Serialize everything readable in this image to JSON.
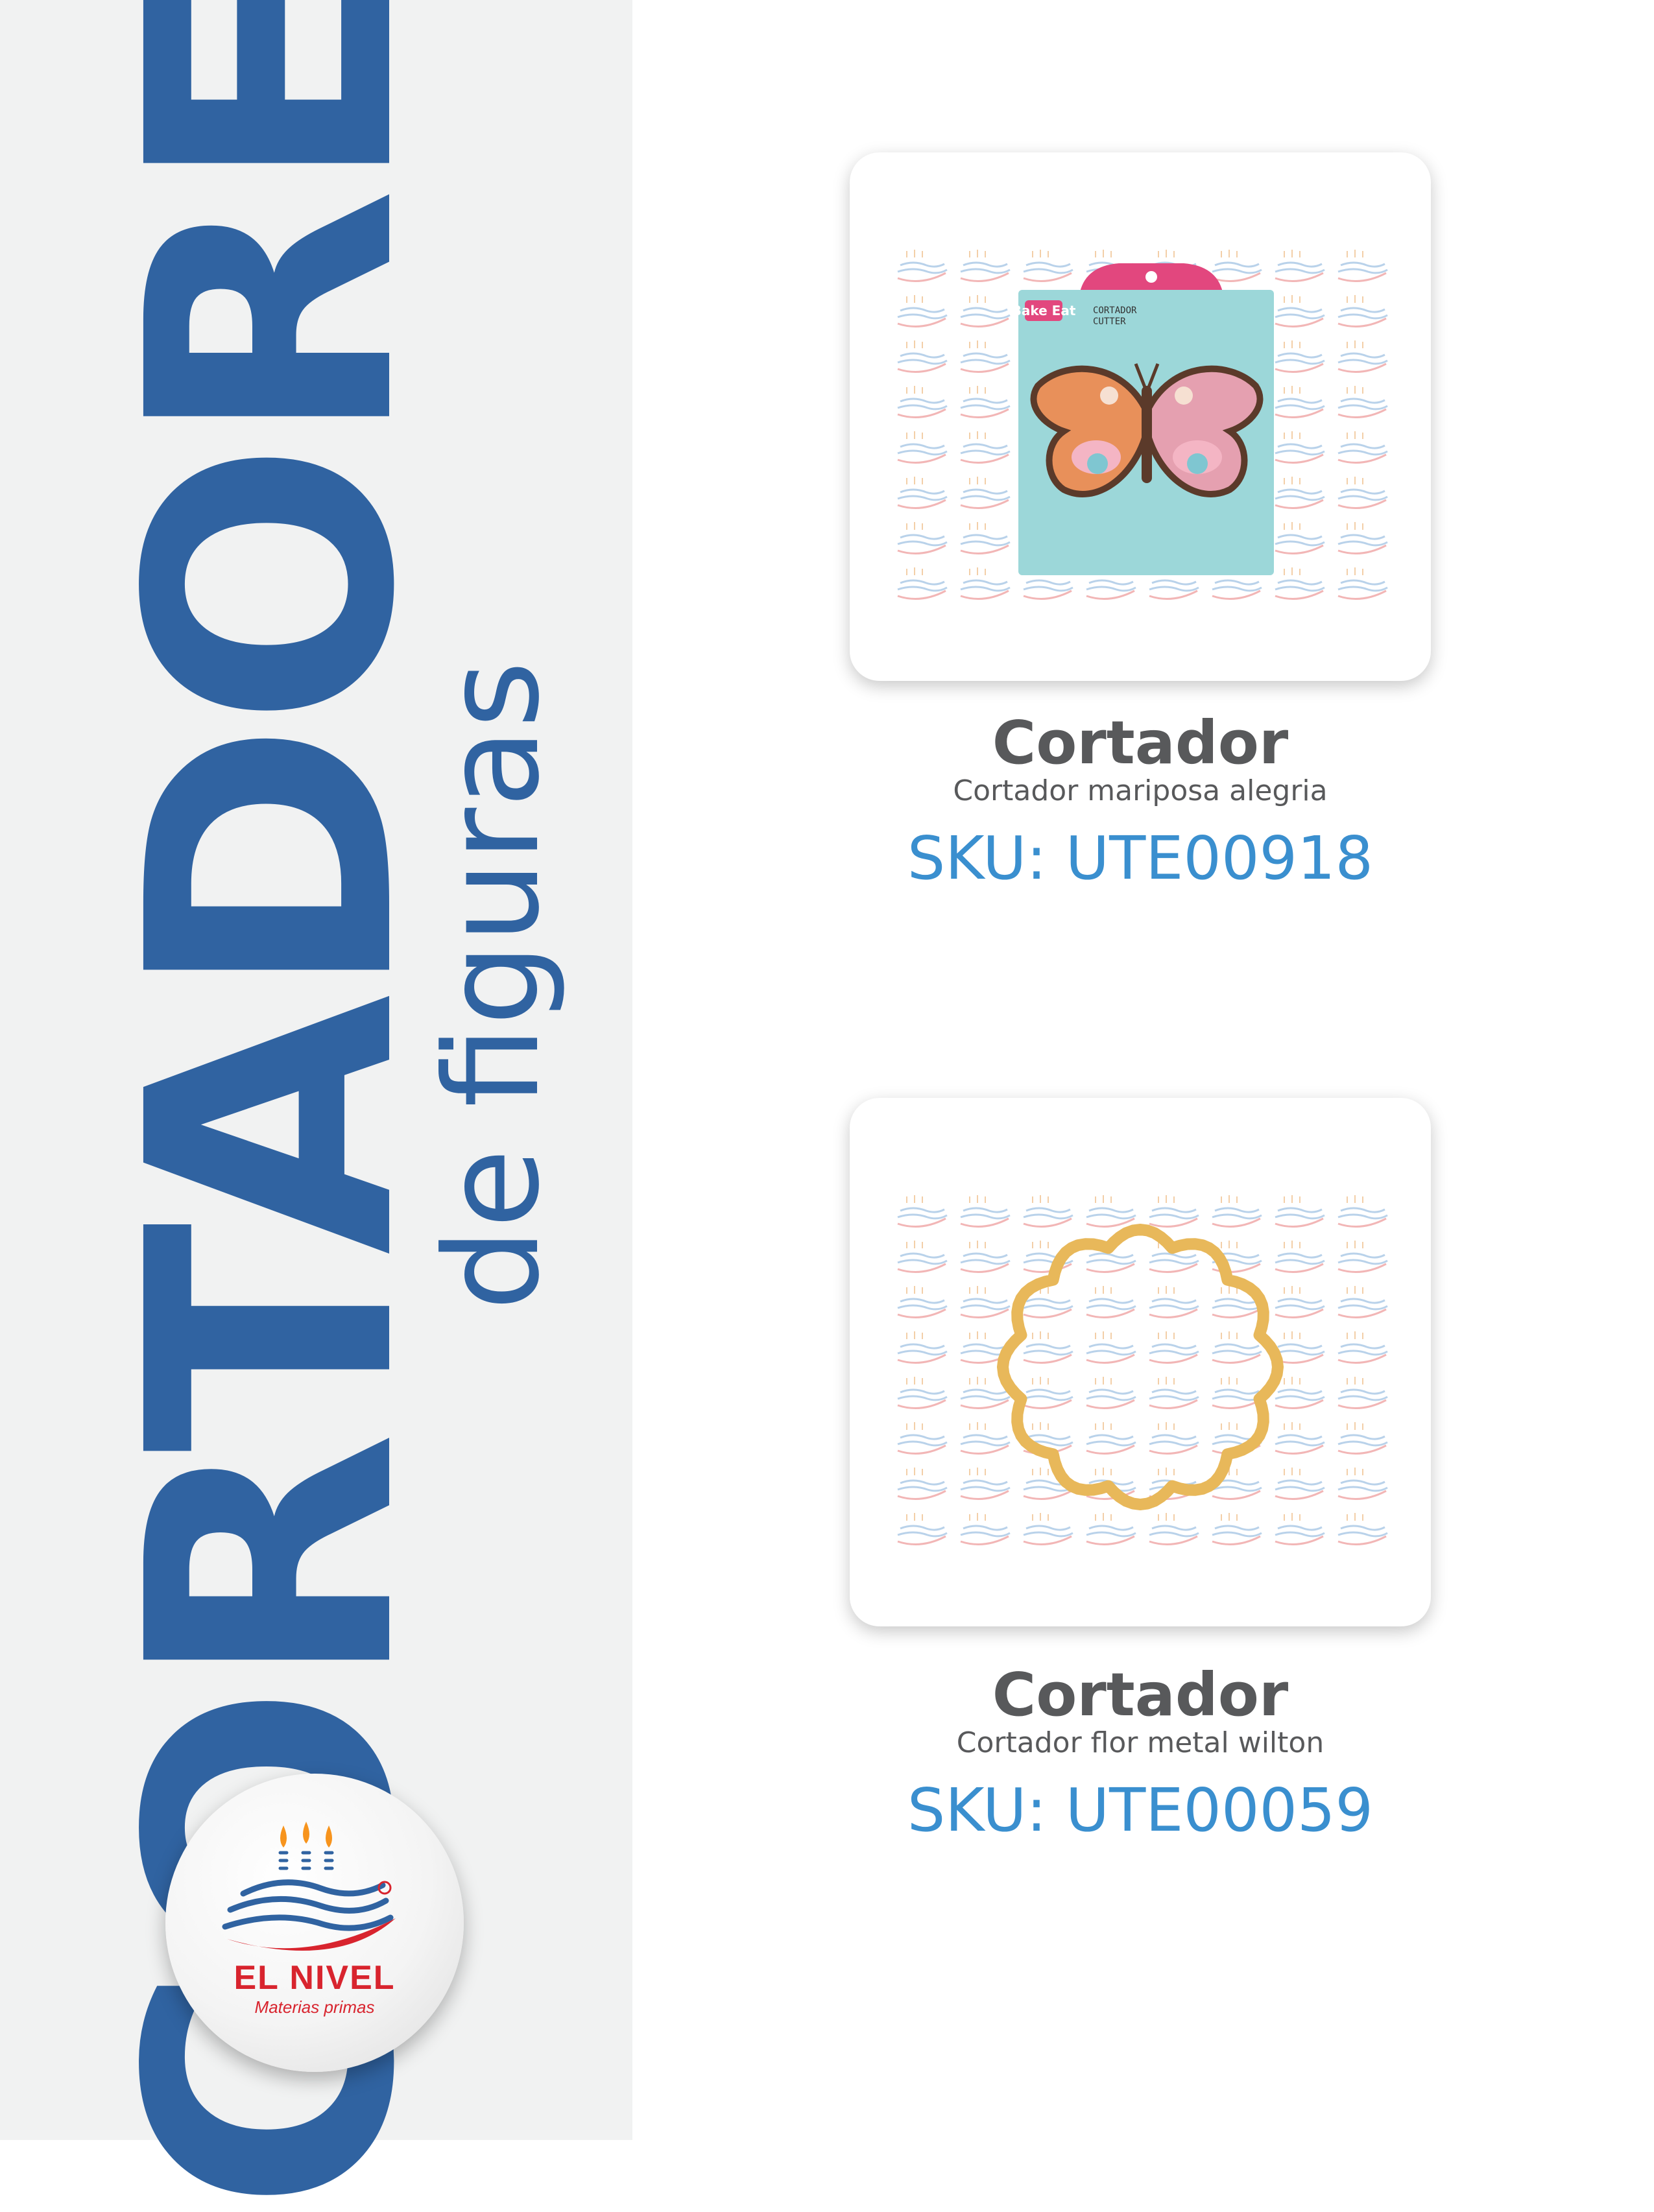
{
  "sidebar": {
    "title": "CORTADORES",
    "subtitle": "de figuras",
    "logo": {
      "name": "EL NIVEL",
      "tagline": "Materias primas",
      "registered": "®"
    }
  },
  "packaging_text": {
    "brand": "Bake Eat",
    "label_line1": "CORTADOR",
    "label_line2": "CUTTER"
  },
  "products": [
    {
      "name": "Cortador",
      "description": "Cortador mariposa alegria",
      "sku": "SKU: UTE00918",
      "image_icon": "butterfly-cutter-package-icon"
    },
    {
      "name": "Cortador",
      "description": "Cortador flor metal wilton",
      "sku": "SKU: UTE00059",
      "image_icon": "flower-cutter-icon"
    }
  ],
  "colors": {
    "title_blue": "#3063a1",
    "sku_blue": "#3a8fcf",
    "name_gray": "#58595b",
    "panel_bg": "#f1f2f2",
    "logo_red": "#d8242e",
    "gold": "#e8b85a"
  }
}
